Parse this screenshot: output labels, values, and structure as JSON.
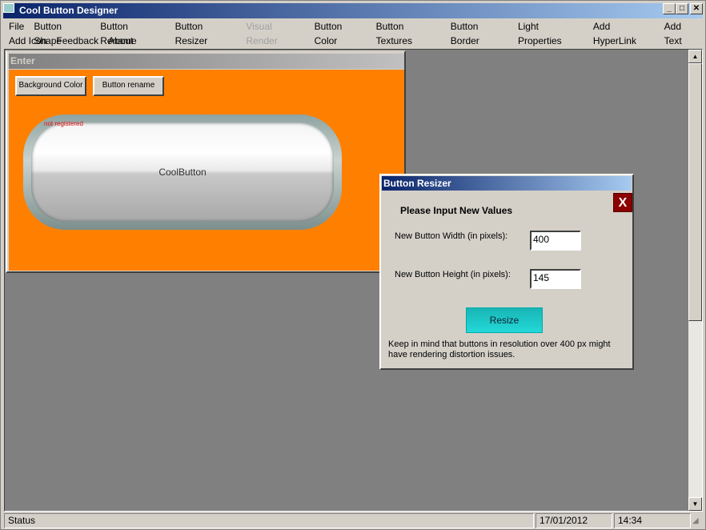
{
  "app": {
    "title": "Cool Button Designer"
  },
  "menu": {
    "row1": [
      "File",
      "Button Shape",
      "Button Rename",
      "Button Resizer",
      "Visual Render",
      "Button Color",
      "Button Textures",
      "Button Border",
      "Light Properties",
      "Add HyperLink",
      "Add Text"
    ],
    "row2": [
      "Add Icon",
      "Feedback",
      "About"
    ],
    "disabled": "Visual Render"
  },
  "child": {
    "title": "Enter",
    "bg_button": "Background Color",
    "rename_button": "Button rename",
    "cool_button_text": "CoolButton",
    "watermark": "not registered",
    "bg_color": "#ff8000"
  },
  "dialog": {
    "title": "Button Resizer",
    "close": "X",
    "heading": "Please Input New Values",
    "width_label": "New Button Width (in pixels):",
    "width_value": "400",
    "height_label": "New Button Height (in pixels):",
    "height_value": "145",
    "resize_button": "Resize",
    "note": "Keep in mind that buttons in resolution over 400 px might have rendering distortion issues."
  },
  "statusbar": {
    "status": "Status",
    "date": "17/01/2012",
    "time": "14:34"
  }
}
